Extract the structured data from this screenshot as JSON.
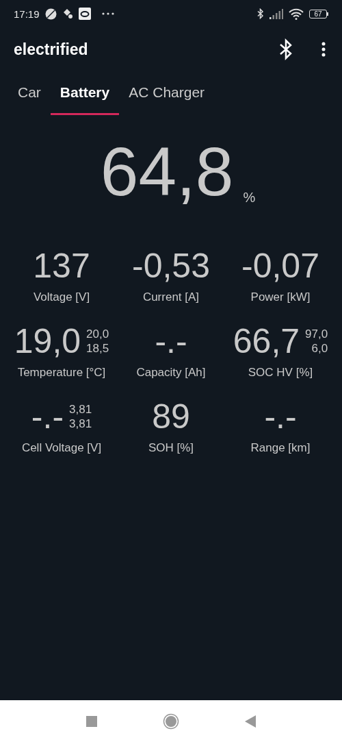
{
  "status_bar": {
    "time": "17:19",
    "battery": "67"
  },
  "app_bar": {
    "title": "electrified"
  },
  "tabs": [
    {
      "label": "Car",
      "selected": false
    },
    {
      "label": "Battery",
      "selected": true
    },
    {
      "label": "AC Charger",
      "selected": false
    }
  ],
  "soc": {
    "value": "64,8",
    "unit": "%"
  },
  "metrics": [
    {
      "value": "137",
      "label": "Voltage [V]"
    },
    {
      "value": "-0,53",
      "label": "Current [A]"
    },
    {
      "value": "-0,07",
      "label": "Power [kW]"
    },
    {
      "value": "19,0",
      "max": "20,0",
      "min": "18,5",
      "label": "Temperature [°C]"
    },
    {
      "value": "-.-",
      "label": "Capacity [Ah]"
    },
    {
      "value": "66,7",
      "max": "97,0",
      "min": "6,0",
      "label": "SOC HV [%]"
    },
    {
      "value": "-.-",
      "max": "3,81",
      "min": "3,81",
      "label": "Cell Voltage [V]"
    },
    {
      "value": "89",
      "label": "SOH [%]"
    },
    {
      "value": "-.-",
      "label": "Range [km]"
    }
  ]
}
